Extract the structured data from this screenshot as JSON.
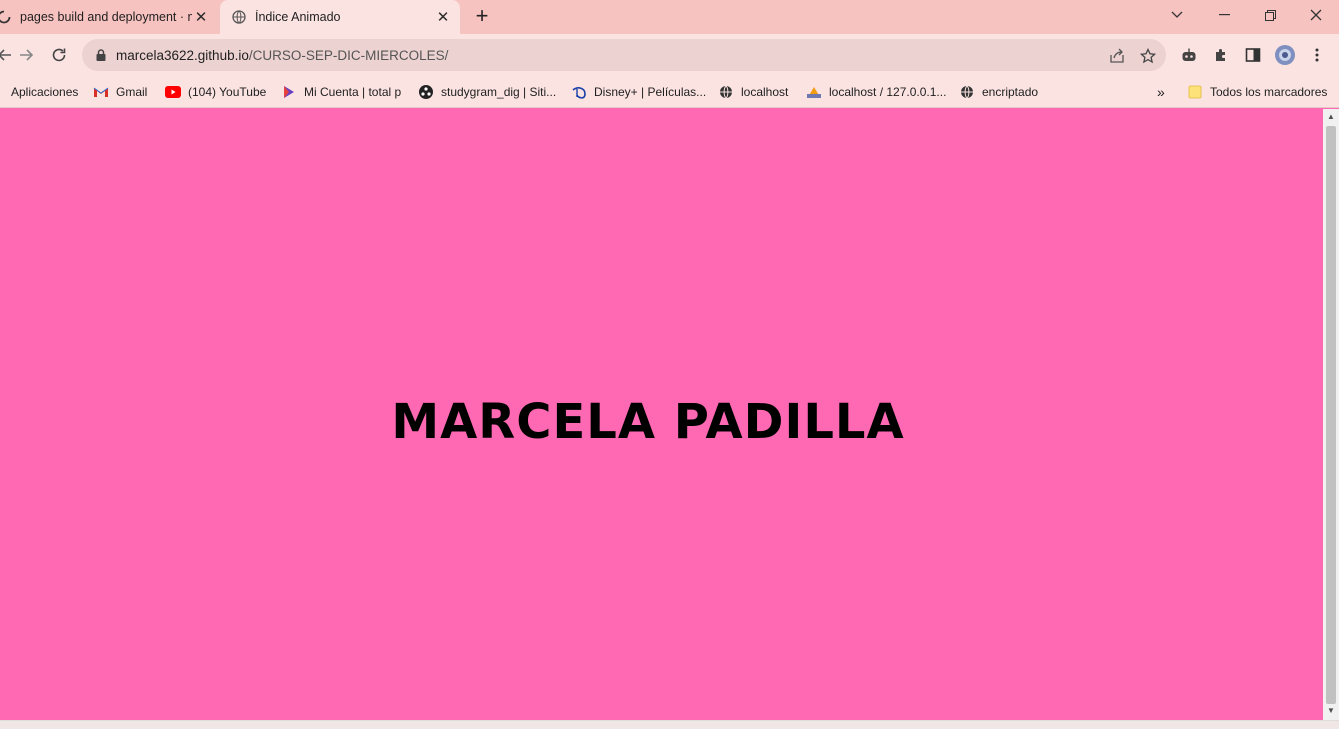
{
  "browser": {
    "tabs": [
      {
        "title": "pages build and deployment · m",
        "active": false
      },
      {
        "title": "Índice Animado",
        "active": true
      }
    ],
    "address_bar": {
      "host": "marcela3622.github.io",
      "path": "/CURSO-SEP-DIC-MIERCOLES/"
    },
    "bookmarks": [
      {
        "label": "Aplicaciones",
        "icon": "apps-grid-icon"
      },
      {
        "label": "Gmail",
        "icon": "gmail-icon"
      },
      {
        "label": "(104) YouTube",
        "icon": "youtube-icon"
      },
      {
        "label": "Mi Cuenta | total p",
        "icon": "totalplay-icon"
      },
      {
        "label": "studygram_dig | Siti...",
        "icon": "globe-icon"
      },
      {
        "label": "Disney+ | Películas...",
        "icon": "disney-icon"
      },
      {
        "label": "localhost",
        "icon": "globe-icon"
      },
      {
        "label": "localhost / 127.0.0.1...",
        "icon": "phpmyadmin-icon"
      },
      {
        "label": "encriptado",
        "icon": "globe-icon"
      }
    ],
    "bookmarks_overflow": "»",
    "all_bookmarks_label": "Todos los marcadores"
  },
  "page": {
    "heading": "MARCELA PADILLA",
    "background_color": "#ff69b4"
  },
  "colors": {
    "tabstrip": "#f7c3c0",
    "toolbar": "#fbe3e2",
    "page_background": "#ff69b4"
  }
}
